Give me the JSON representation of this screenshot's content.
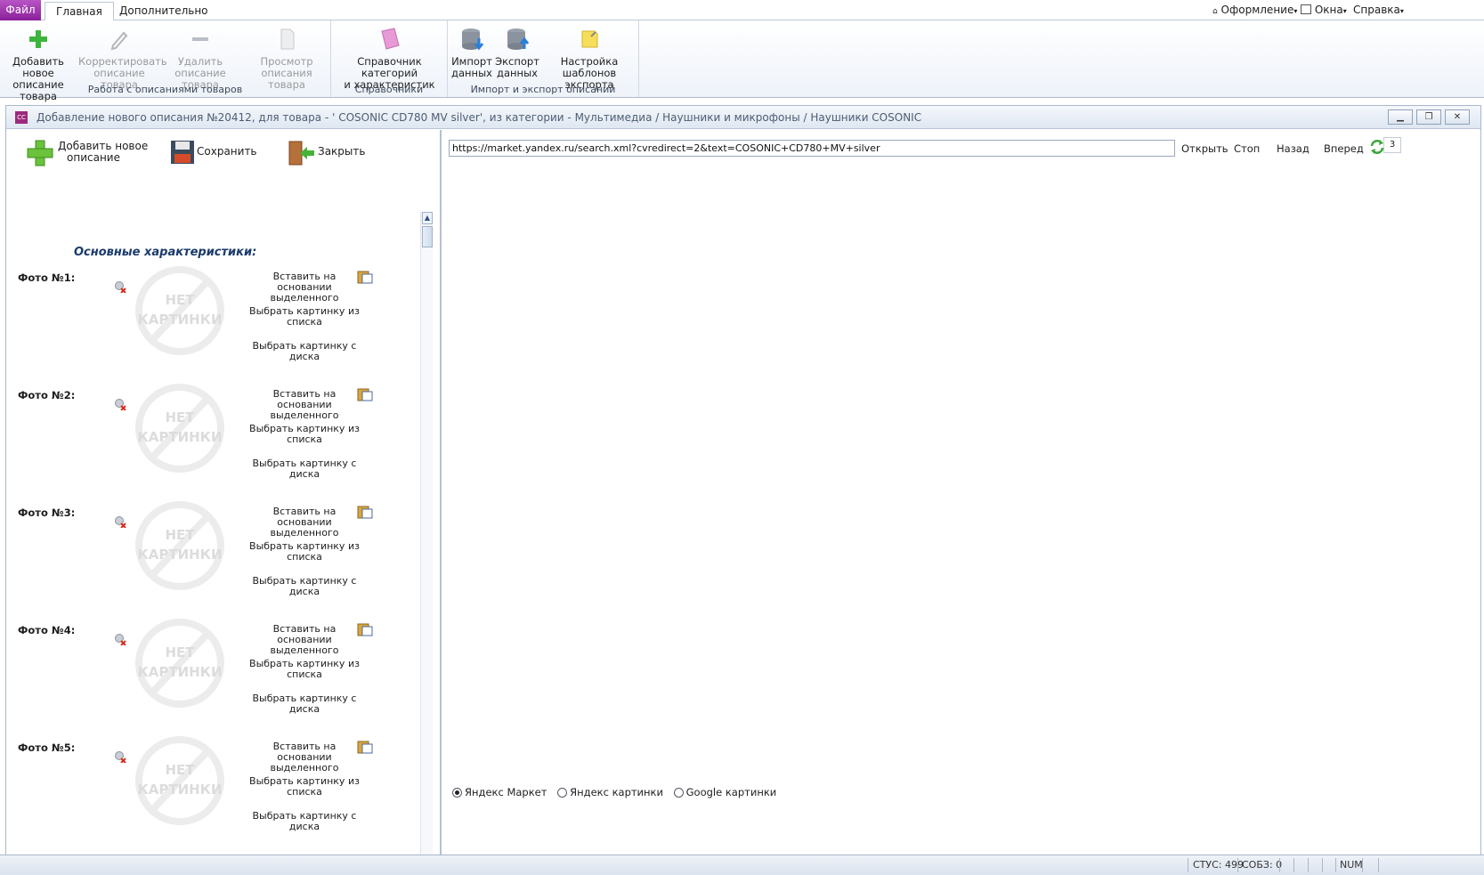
{
  "tabs": {
    "file": "Файл",
    "home": "Главная",
    "extra": "Дополнительно"
  },
  "topbar": {
    "design": "Оформление",
    "windows": "Окна",
    "help": "Справка"
  },
  "ribbon": {
    "groups": [
      {
        "caption": "Работа с описаниями товаров",
        "buttons": [
          {
            "label1": "Добавить новое",
            "label2": "описание товара",
            "icon": "add-icon",
            "enabled": true
          },
          {
            "label1": "Корректировать",
            "label2": "описание товара",
            "icon": "edit-icon",
            "enabled": false
          },
          {
            "label1": "Удалить",
            "label2": "описание товара",
            "icon": "remove-icon",
            "enabled": false
          },
          {
            "label1": "Просмотр",
            "label2": "описания товара",
            "icon": "view-icon",
            "enabled": false
          }
        ]
      },
      {
        "caption": "Справочники",
        "buttons": [
          {
            "label1": "Справочник категорий",
            "label2": "и характеристик",
            "icon": "book-icon",
            "enabled": true
          }
        ]
      },
      {
        "caption": "Импорт и экспорт описаний",
        "buttons": [
          {
            "label1": "Импорт",
            "label2": "данных",
            "icon": "database-import-icon",
            "enabled": true
          },
          {
            "label1": "Экспорт",
            "label2": "данных",
            "icon": "database-export-icon",
            "enabled": true
          },
          {
            "label1": "Настройка",
            "label2": "шаблонов экспорта",
            "icon": "note-settings-icon",
            "enabled": true
          }
        ]
      }
    ]
  },
  "mdi": {
    "title": "Добавление нового описания №20412, для товара - '  COSONIC CD780 MV silver', из категории - Мультимедиа / Наушники и микрофоны / Наушники COSONIC",
    "icon_text": "CC"
  },
  "toolbar": {
    "add_line1": "Добавить новое",
    "add_line2": "описание",
    "save": "Сохранить",
    "close": "Закрыть"
  },
  "section_title": "Основные характеристики:",
  "no_picture": {
    "line1": "НЕТ",
    "line2": "КАРТИНКИ"
  },
  "photos": [
    {
      "label": "Фото №1:"
    },
    {
      "label": "Фото №2:"
    },
    {
      "label": "Фото №3:"
    },
    {
      "label": "Фото №4:"
    },
    {
      "label": "Фото №5:"
    }
  ],
  "photo_actions": {
    "paste_line1": "Вставить на основании",
    "paste_line2": "выделенного",
    "list_line1": "Выбрать картинку из",
    "list_line2": "списка",
    "disk_line1": "Выбрать картинку с",
    "disk_line2": "диска"
  },
  "browser": {
    "url": "https://market.yandex.ru/search.xml?cvredirect=2&text=COSONIC+CD780+MV+silver",
    "open": "Открыть",
    "stop": "Стоп",
    "back": "Назад",
    "forward": "Вперед",
    "counter": "3"
  },
  "search_sources": [
    {
      "label": "Яндекс Маркет",
      "selected": true
    },
    {
      "label": "Яндекс картинки",
      "selected": false
    },
    {
      "label": "Google картинки",
      "selected": false
    }
  ],
  "status": {
    "stus": "СТУС: 499",
    "sobz": "СОБЗ: 0",
    "num": "NUM"
  },
  "colors": {
    "accent": "#8a1f9a",
    "title_blue": "#1a3b6b"
  }
}
